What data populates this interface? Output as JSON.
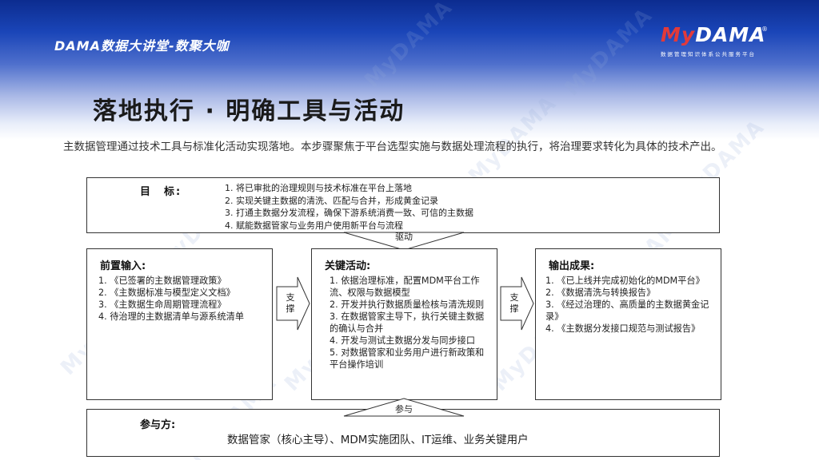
{
  "header": {
    "brand": "DAMA数据大讲堂-数聚大咖",
    "logo": {
      "my": "My",
      "dama": "DAMA",
      "registered": "®",
      "tagline": "数据管理知识体系公共服务平台"
    },
    "watermark_text": "MyDAMA"
  },
  "title": "落地执行 · 明确工具与活动",
  "intro": "主数据管理通过技术工具与标准化活动实现落地。本步骤聚焦于平台选型实施与数据处理流程的执行，将治理要求转化为具体的技术产出。",
  "goal": {
    "label": "目　标:",
    "items": [
      "1. 将已审批的治理规则与技术标准在平台上落地",
      "2. 实现关键主数据的清洗、匹配与合并，形成黄金记录",
      "3. 打通主数据分发流程，确保下游系统消费一致、可信的主数据",
      "4. 赋能数据管家与业务用户使用新平台与流程"
    ]
  },
  "arrows": {
    "drive": "驱动",
    "support_left": "支撑",
    "support_right": "支撑",
    "participate": "参与"
  },
  "inputs": {
    "title": "前置输入:",
    "items": [
      "1. 《已签署的主数据管理政策》",
      "2. 《主数据标准与模型定义文档》",
      "3. 《主数据生命周期管理流程》",
      "4. 待治理的主数据清单与源系统清单"
    ]
  },
  "activities": {
    "title": "关键活动:",
    "items": [
      "1. 依据治理标准，配置MDM平台工作流、权限与数据模型",
      "2. 开发并执行数据质量检核与清洗规则",
      "3. 在数据管家主导下，执行关键主数据的确认与合并",
      "4. 开发与测试主数据分发与同步接口",
      "5. 对数据管家和业务用户进行新政策和平台操作培训"
    ]
  },
  "outputs": {
    "title": "输出成果:",
    "items": [
      "1. 《已上线并完成初始化的MDM平台》",
      "2. 《数据清洗与转换报告》",
      "3. 《经过治理的、高质量的主数据黄金记录》",
      "4. 《主数据分发接口规范与测试报告》"
    ]
  },
  "participants": {
    "label": "参与方:",
    "text": "数据管家（核心主导）、MDM实施团队、IT运维、业务关键用户"
  },
  "colors": {
    "banner_top": "#0c2c8f",
    "logo_red": "#e23a3a",
    "border": "#333333"
  }
}
